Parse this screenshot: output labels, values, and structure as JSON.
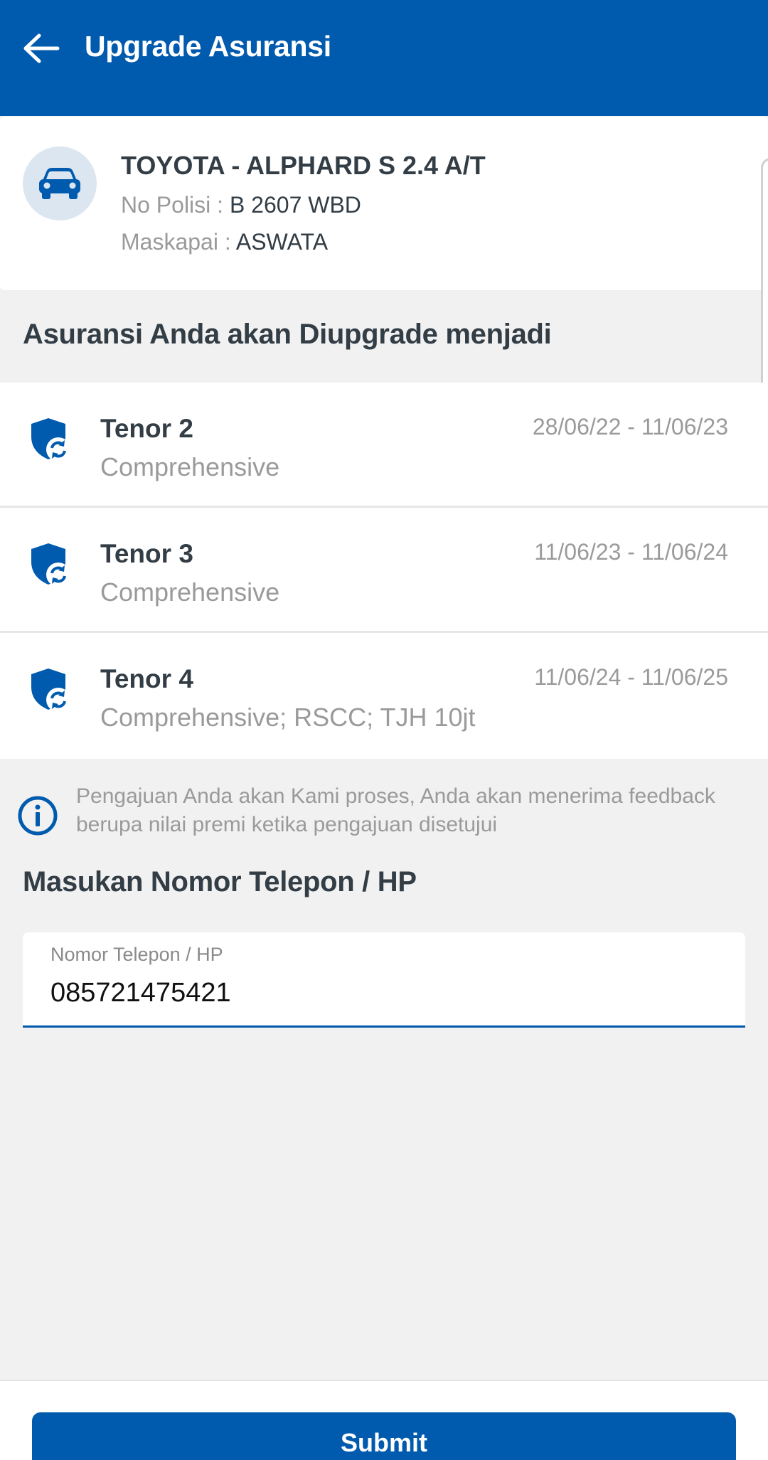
{
  "header": {
    "title": "Upgrade Asuransi",
    "back_icon": "arrow-left-icon"
  },
  "vehicle": {
    "icon": "car-icon",
    "name": "TOYOTA - ALPHARD S 2.4 A/T",
    "polisi_label": "No Polisi : ",
    "polisi_value": "B 2607 WBD",
    "maskapai_label": "Maskapai : ",
    "maskapai_value": "ASWATA"
  },
  "upgrade_section": {
    "title": "Asuransi Anda akan Diupgrade menjadi",
    "tenors": [
      {
        "name": "Tenor 2",
        "coverage": "Comprehensive",
        "period": "28/06/22 - 11/06/23",
        "icon": "shield-refresh-icon"
      },
      {
        "name": "Tenor 3",
        "coverage": "Comprehensive",
        "period": "11/06/23 - 11/06/24",
        "icon": "shield-refresh-icon"
      },
      {
        "name": "Tenor 4",
        "coverage": "Comprehensive; RSCC; TJH 10jt",
        "period": "11/06/24 - 11/06/25",
        "icon": "shield-refresh-icon"
      }
    ]
  },
  "info": {
    "icon": "info-icon",
    "text": "Pengajuan Anda akan Kami proses, Anda akan menerima feedback berupa nilai premi ketika pengajuan disetujui"
  },
  "phone": {
    "heading": "Masukan Nomor Telepon / HP",
    "label": "Nomor Telepon / HP",
    "value": "085721475421"
  },
  "submit": {
    "label": "Submit"
  },
  "colors": {
    "primary": "#005aad",
    "background": "#f1f1f1",
    "text_dark": "#333d45",
    "text_muted": "#9a9a9a"
  }
}
